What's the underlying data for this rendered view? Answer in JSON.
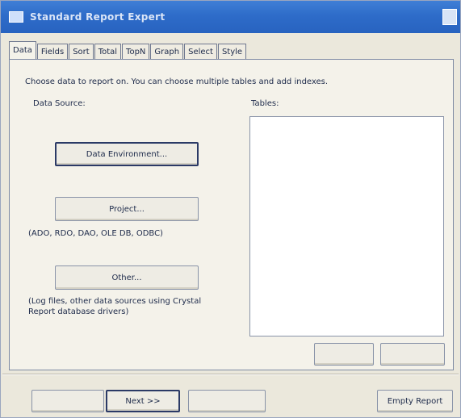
{
  "window": {
    "title": "Standard Report Expert"
  },
  "tabs": [
    {
      "label": "Data"
    },
    {
      "label": "Fields"
    },
    {
      "label": "Sort"
    },
    {
      "label": "Total"
    },
    {
      "label": "TopN"
    },
    {
      "label": "Graph"
    },
    {
      "label": "Select"
    },
    {
      "label": "Style"
    }
  ],
  "data_tab": {
    "instruction": "Choose data to report on. You can choose multiple tables and add indexes.",
    "data_source_label": "Data Source:",
    "tables_label": "Tables:",
    "data_environment_button": "Data Environment...",
    "project_button": "Project...",
    "project_hint": "(ADO, RDO, DAO, OLE DB, ODBC)",
    "other_button": "Other...",
    "other_hint_line1": "(Log files, other data sources using Crystal",
    "other_hint_line2": "Report database drivers)",
    "tables_button_1": "",
    "tables_button_2": ""
  },
  "footer": {
    "back_button": "",
    "next_button": "Next >>",
    "cancel_button": "",
    "empty_report_button": "Empty Report"
  },
  "colors": {
    "titlebar": "#2e6cc9",
    "window_bg": "#ebe8dc",
    "text": "#1d2a4a"
  }
}
